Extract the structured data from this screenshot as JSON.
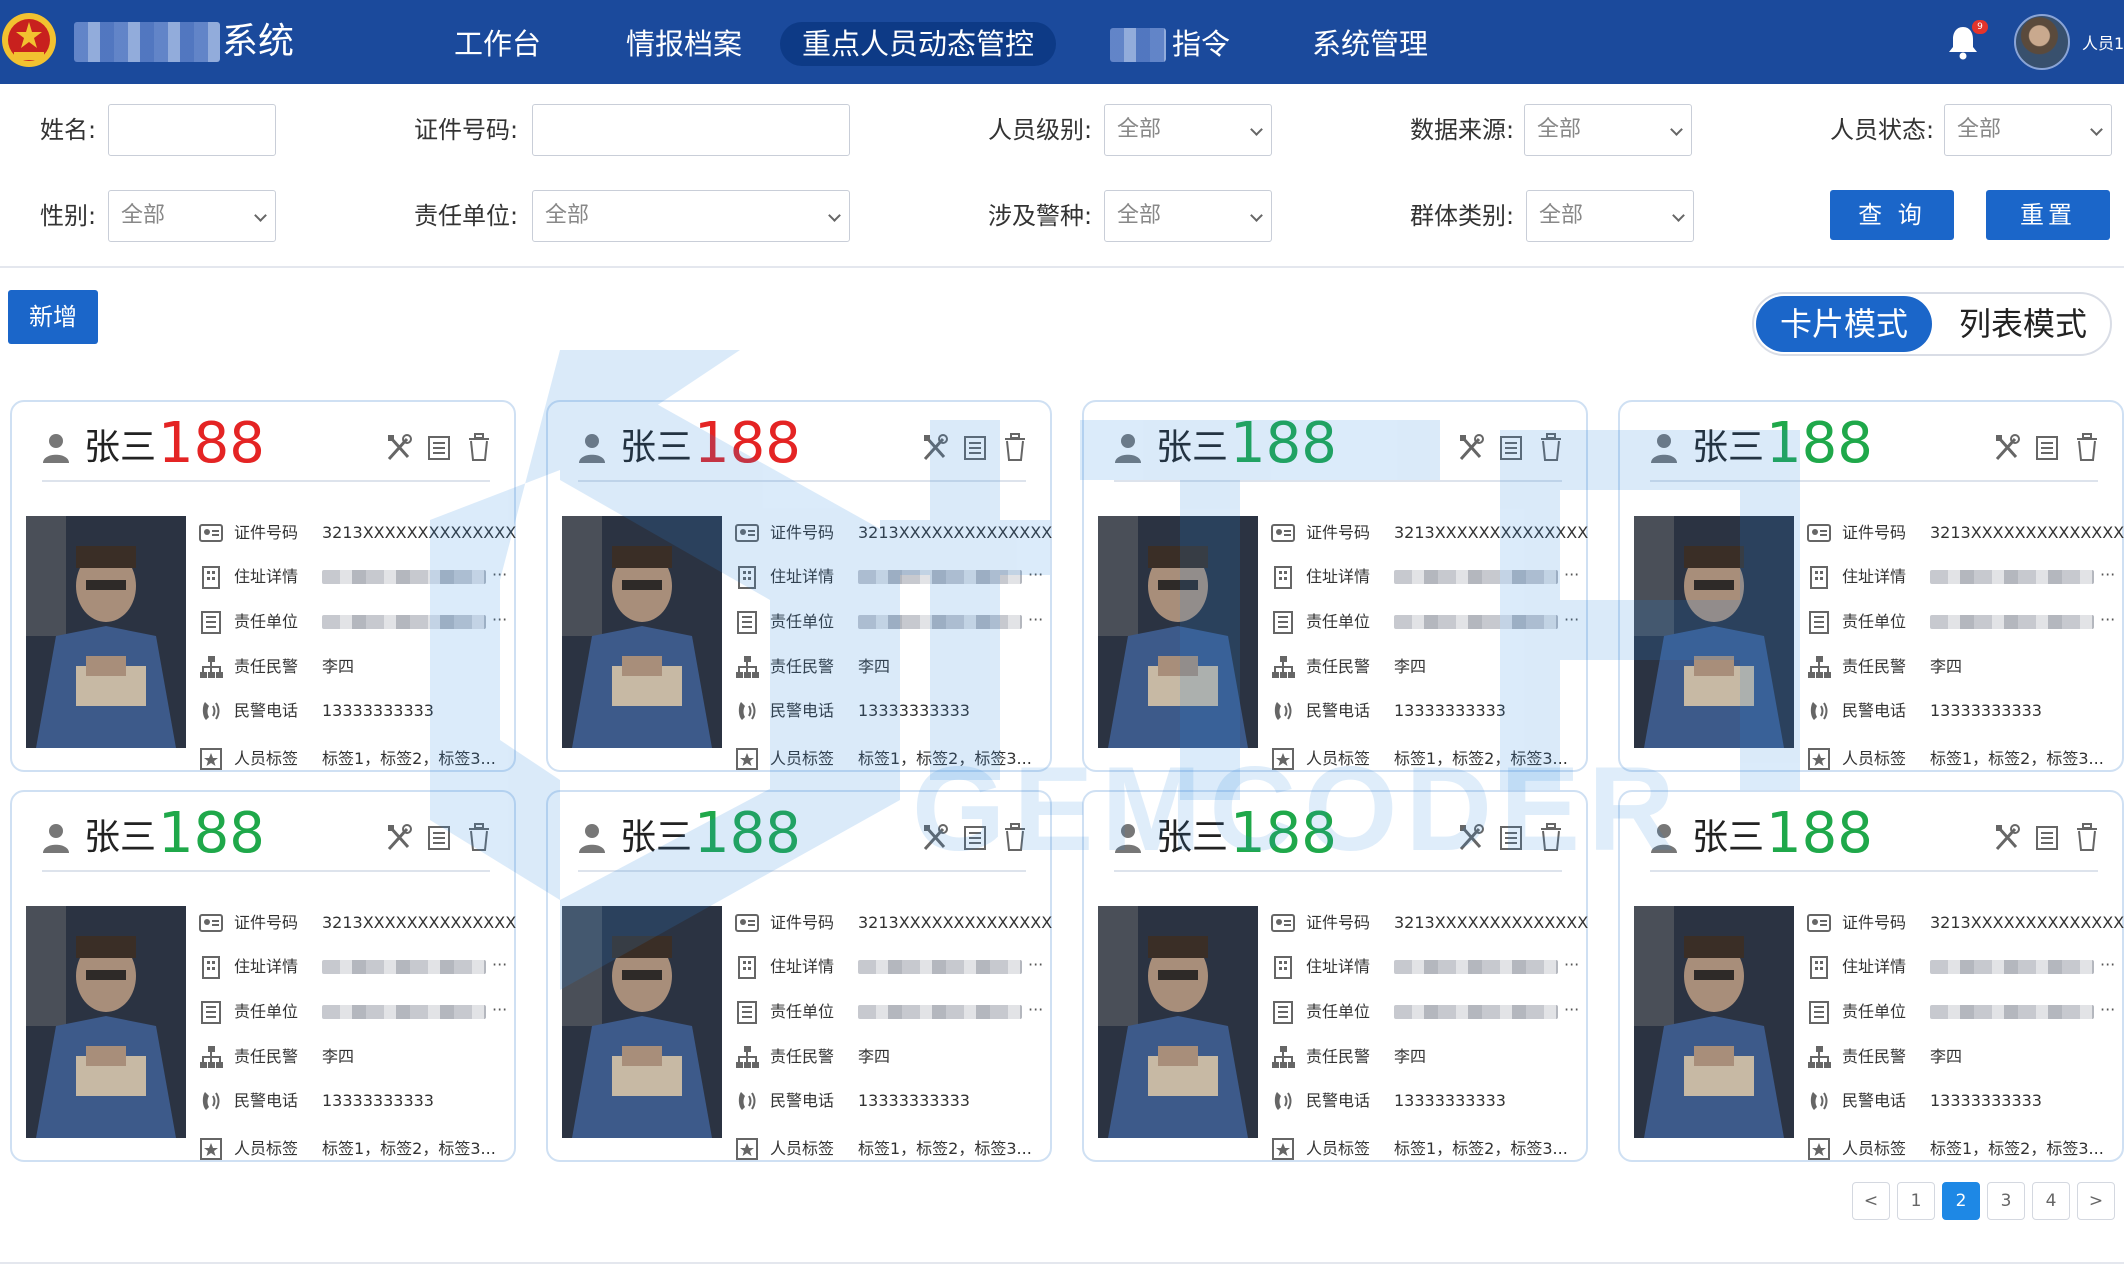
{
  "header": {
    "app_title": "系统",
    "nav": [
      "工作台",
      "情报档案",
      "重点人员动态管控",
      "指令",
      "系统管理"
    ],
    "active_nav": "重点人员动态管控",
    "notification_count": "9",
    "user_name": "人员1"
  },
  "filters": {
    "name_label": "姓名:",
    "id_label": "证件号码:",
    "level_label": "人员级别:",
    "source_label": "数据来源:",
    "status_label": "人员状态:",
    "gender_label": "性别:",
    "unit_label": "责任单位:",
    "police_label": "涉及警种:",
    "group_label": "群体类别:",
    "select_default": "全部",
    "query_button": "查 询",
    "reset_button": "重置"
  },
  "toolbar": {
    "add_button": "新增",
    "mode_card": "卡片模式",
    "mode_list": "列表模式",
    "active_mode": "卡片模式"
  },
  "watermark": {
    "text": "GEMCODER"
  },
  "field_labels": {
    "id": "证件号码",
    "address": "住址详情",
    "unit": "责任单位",
    "officer": "责任民警",
    "phone": "民警电话",
    "tags": "人员标签"
  },
  "cards": [
    {
      "name": "张三",
      "score": "188",
      "score_color": "red",
      "id": "3213XXXXXXXXXXXXXX",
      "officer": "李四",
      "phone": "13333333333",
      "tags": "标签1，标签2，标签3..."
    },
    {
      "name": "张三",
      "score": "188",
      "score_color": "red",
      "id": "3213XXXXXXXXXXXXXX",
      "officer": "李四",
      "phone": "13333333333",
      "tags": "标签1，标签2，标签3..."
    },
    {
      "name": "张三",
      "score": "188",
      "score_color": "green",
      "id": "3213XXXXXXXXXXXXXX",
      "officer": "李四",
      "phone": "13333333333",
      "tags": "标签1，标签2，标签3..."
    },
    {
      "name": "张三",
      "score": "188",
      "score_color": "green",
      "id": "3213XXXXXXXXXXXXXX",
      "officer": "李四",
      "phone": "13333333333",
      "tags": "标签1，标签2，标签3..."
    },
    {
      "name": "张三",
      "score": "188",
      "score_color": "green",
      "id": "3213XXXXXXXXXXXXXX",
      "officer": "李四",
      "phone": "13333333333",
      "tags": "标签1，标签2，标签3..."
    },
    {
      "name": "张三",
      "score": "188",
      "score_color": "green",
      "id": "3213XXXXXXXXXXXXXX",
      "officer": "李四",
      "phone": "13333333333",
      "tags": "标签1，标签2，标签3..."
    },
    {
      "name": "张三",
      "score": "188",
      "score_color": "green",
      "id": "3213XXXXXXXXXXXXXX",
      "officer": "李四",
      "phone": "13333333333",
      "tags": "标签1，标签2，标签3..."
    },
    {
      "name": "张三",
      "score": "188",
      "score_color": "green",
      "id": "3213XXXXXXXXXXXXXX",
      "officer": "李四",
      "phone": "13333333333",
      "tags": "标签1，标签2，标签3..."
    }
  ],
  "pagination": {
    "prev": "<",
    "pages": [
      "1",
      "2",
      "3",
      "4"
    ],
    "current": "2",
    "next": ">"
  }
}
